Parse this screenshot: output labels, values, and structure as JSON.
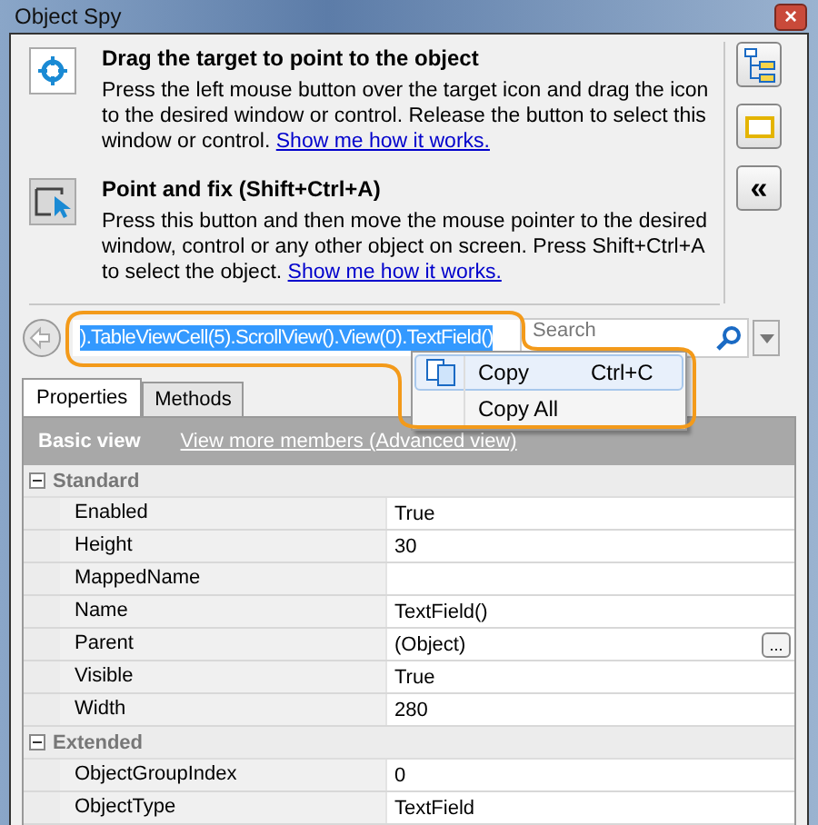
{
  "window": {
    "title": "Object Spy",
    "close": "×"
  },
  "modes": [
    {
      "kind": "target",
      "title": "Drag the target to point to the object",
      "description": "Press the left mouse button over the target icon and drag the icon to the desired window or control. Release the button to select this window or control.",
      "link": "Show me how it works."
    },
    {
      "kind": "pointer",
      "title": "Point and fix (Shift+Ctrl+A)",
      "description": "Press this button and then move the mouse pointer to the desired window, control or any other object on screen. Press Shift+Ctrl+A to select the object.",
      "link": "Show me how it works."
    }
  ],
  "side_buttons": [
    {
      "kind": "tree"
    },
    {
      "kind": "highlight"
    },
    {
      "kind": "text",
      "label": "«"
    }
  ],
  "path_bar": {
    "value": ").TableViewCell(5).ScrollView().View(0).TextField()",
    "selected": true,
    "search_placeholder": "Search"
  },
  "tabs": [
    {
      "label": "Properties",
      "selected": true
    },
    {
      "label": "Methods",
      "selected": false
    }
  ],
  "grid": {
    "header": "Basic view",
    "link": "View more members (Advanced view)",
    "categories": [
      {
        "name": "Standard",
        "expanded": true,
        "rows": [
          {
            "name": "Enabled",
            "value": "True"
          },
          {
            "name": "Height",
            "value": "30"
          },
          {
            "name": "MappedName",
            "value": ""
          },
          {
            "name": "Name",
            "value": "TextField()"
          },
          {
            "name": "Parent",
            "value": "(Object)",
            "button": "..."
          },
          {
            "name": "Visible",
            "value": "True"
          },
          {
            "name": "Width",
            "value": "280"
          }
        ]
      },
      {
        "name": "Extended",
        "expanded": true,
        "rows": [
          {
            "name": "ObjectGroupIndex",
            "value": "0"
          },
          {
            "name": "ObjectType",
            "value": "TextField"
          }
        ]
      }
    ]
  },
  "context_menu": {
    "items": [
      {
        "label": "Copy",
        "shortcut": "Ctrl+C",
        "selected": true,
        "icon": true
      },
      {
        "label": "Copy All",
        "selected": false,
        "icon": false
      }
    ]
  }
}
